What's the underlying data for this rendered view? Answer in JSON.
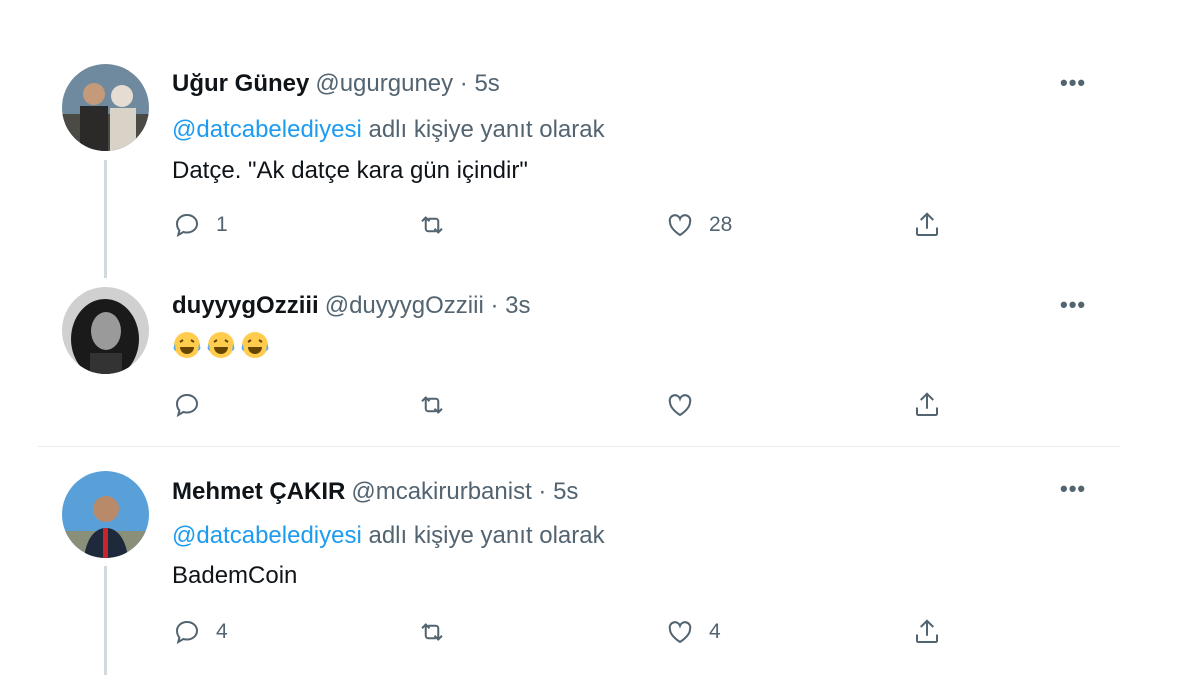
{
  "tweets": [
    {
      "name": "Uğur Güney",
      "handle": "@ugurguney · 5s",
      "reply_mention": "@datcabelediyesi",
      "reply_suffix": "adlı kişiye yanıt olarak",
      "text": "Datçe. \"Ak datçe kara gün içindir\"",
      "replies": "1",
      "retweets": "",
      "likes": "28"
    },
    {
      "name": "duyyygOzziii",
      "handle": "@duyyygOzziii · 3s",
      "emoji_count": 3,
      "replies": "",
      "retweets": "",
      "likes": ""
    },
    {
      "name": "Mehmet ÇAKIR",
      "handle": "@mcakirurbanist · 5s",
      "reply_mention": "@datcabelediyesi",
      "reply_suffix": "adlı kişiye yanıt olarak",
      "text": "BademCoin",
      "replies": "4",
      "retweets": "",
      "likes": "4"
    }
  ],
  "more_label": "•••",
  "colors": {
    "accent": "#1d9bf0",
    "secondary_text": "#536471",
    "thread_line": "#cfd9de"
  },
  "icons": [
    "reply-icon",
    "retweet-icon",
    "like-icon",
    "share-icon",
    "more-icon"
  ]
}
